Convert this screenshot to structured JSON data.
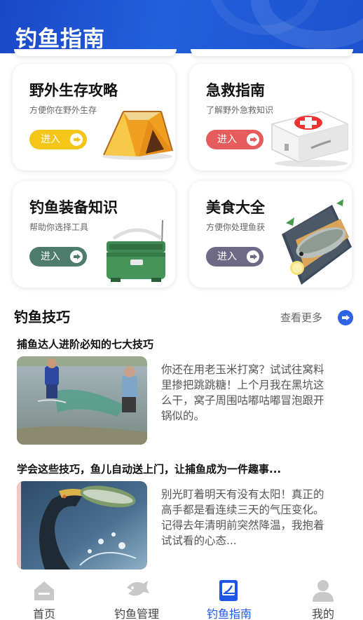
{
  "header": {
    "title": "钓鱼指南"
  },
  "cards": [
    {
      "title": "野外生存攻略",
      "subtitle": "方便你在野外生存",
      "button": "进入",
      "color": "#f5c518",
      "art": "tent-icon"
    },
    {
      "title": "急救指南",
      "subtitle": "了解野外急救知识",
      "button": "进入",
      "color": "#e65c5c",
      "art": "first-aid-kit-icon"
    },
    {
      "title": "钓鱼装备知识",
      "subtitle": "帮助你选择工具",
      "button": "进入",
      "color": "#4e7c6c",
      "art": "tackle-box-icon"
    },
    {
      "title": "美食大全",
      "subtitle": "方便你处理鱼获",
      "button": "进入",
      "color": "#6e6a86",
      "art": "fish-dish-icon"
    }
  ],
  "tips": {
    "title": "钓鱼技巧",
    "more": "查看更多",
    "articles": [
      {
        "title": "捕鱼达人进阶必知的七大技巧",
        "excerpt": "你还在用老玉米打窝？试试往窝料里掺把跳跳糖！上个月我在黑坑这么干，窝子周围咕嘟咕嘟冒泡跟开锅似的。",
        "image": "fishermen-net-photo"
      },
      {
        "title": "学会这些技巧，鱼儿自动送上门，让捕鱼成为一件趣事...",
        "excerpt": "别光盯着明天有没有太阳！真正的高手都是看连续三天的气压变化。记得去年清明前突然降温，我抱着试试看的心态...",
        "image": "cormorant-fish-photo"
      }
    ]
  },
  "tabbar": {
    "items": [
      {
        "label": "首页",
        "icon": "home-icon",
        "active": false
      },
      {
        "label": "钓鱼管理",
        "icon": "fish-icon",
        "active": false
      },
      {
        "label": "钓鱼指南",
        "icon": "guide-book-icon",
        "active": true
      },
      {
        "label": "我的",
        "icon": "user-icon",
        "active": false
      }
    ]
  },
  "colors": {
    "primary": "#1e56e6",
    "header": "#1f55d2"
  }
}
